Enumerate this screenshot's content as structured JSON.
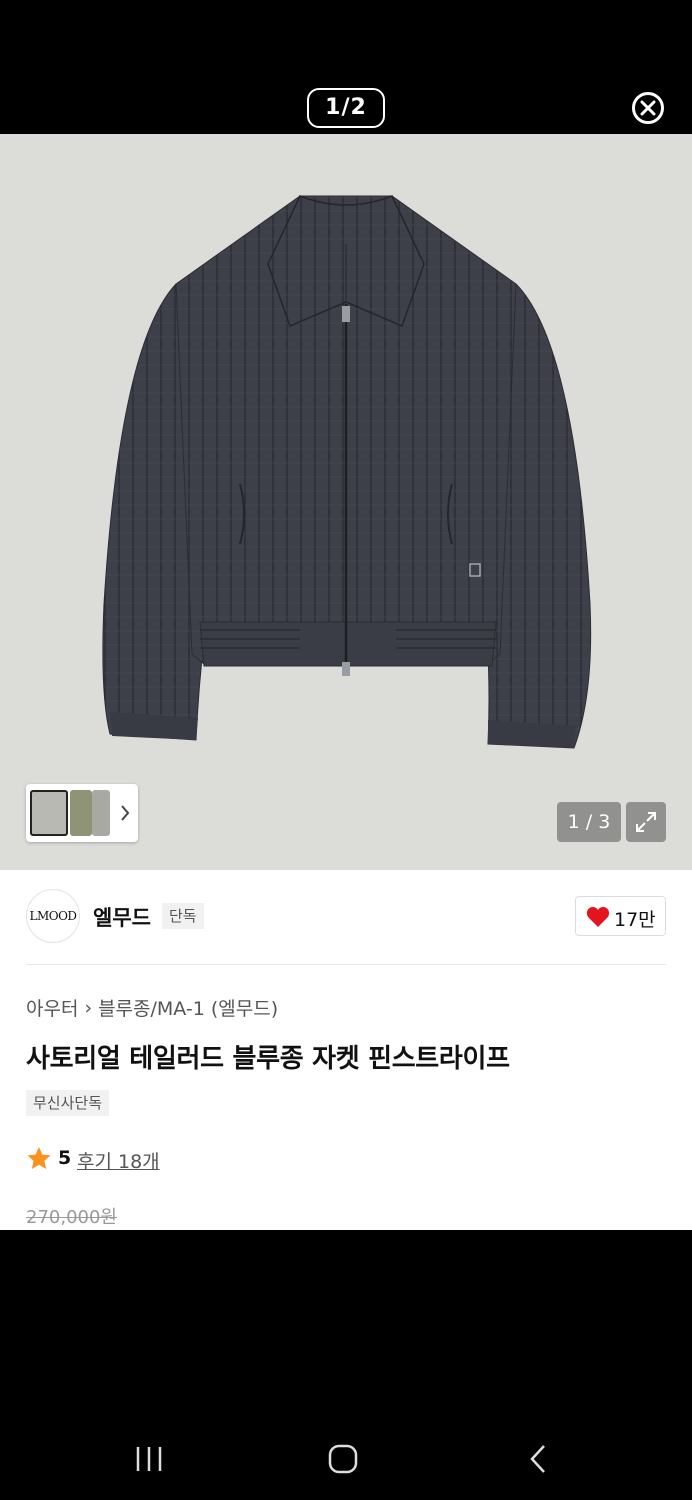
{
  "viewer": {
    "page_counter": "1/2",
    "close_icon": "close-circle-icon"
  },
  "product_image": {
    "image_counter": "1 / 3",
    "thumbnail_count": 3,
    "expand_icon": "expand-icon",
    "next_icon": "chevron-right-icon",
    "background_color": "#dcdcd8",
    "jacket_color": "#3d4049"
  },
  "brand": {
    "logo_text": "LMOOD",
    "name": "엘무드",
    "tag": "단독"
  },
  "like": {
    "icon": "heart-icon",
    "count": "17만",
    "color": "#e3141e"
  },
  "breadcrumb": {
    "category": "아우터",
    "separator": "›",
    "subcategory": "블루종/MA-1 (엘무드)"
  },
  "product": {
    "title": "사토리얼 테일러드 블루종 자켓 핀스트라이프",
    "badge": "무신사단독",
    "rating": "5",
    "review_label": "후기 18개",
    "star_color": "#f7941d",
    "original_price": "270,000원"
  },
  "navigation": {
    "recent_apps_icon": "recent-apps-icon",
    "home_icon": "home-icon",
    "back_icon": "back-icon"
  }
}
